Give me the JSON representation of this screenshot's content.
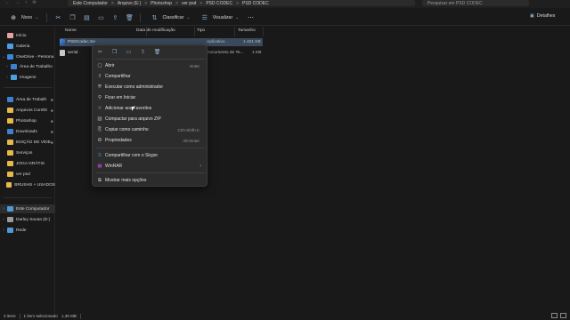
{
  "address": {
    "crumbs": [
      "Este Computador",
      "Arquivo (E:)",
      "Photoshop",
      "ver psd",
      "PSD CODEC",
      "PSD CODEC"
    ],
    "separator": ">",
    "search_placeholder": "Pesquisar em PSD CODEC"
  },
  "toolbar": {
    "new_label": "Novo",
    "sort_label": "Classificar",
    "view_label": "Visualizar",
    "details_label": "Detalhes"
  },
  "sidebar": {
    "items": [
      {
        "label": "Início",
        "icon": "home-icon"
      },
      {
        "label": "Galeria",
        "icon": "gallery-icon"
      },
      {
        "label": "OneDrive - Persona",
        "icon": "cloud-icon"
      },
      {
        "label": "Área de Trabalho",
        "icon": "folder-icon"
      },
      {
        "label": "Imagens",
        "icon": "images-icon"
      },
      {
        "label": "Área de Trabalh",
        "icon": "folder-icon"
      },
      {
        "label": "Arquivos CorelD",
        "icon": "folder-icon"
      },
      {
        "label": "Photoshop",
        "icon": "folder-icon"
      },
      {
        "label": "Downloads",
        "icon": "download-icon"
      },
      {
        "label": "EDIÇÃO DE VÍDE",
        "icon": "folder-icon"
      },
      {
        "label": "Serviços",
        "icon": "folder-icon"
      },
      {
        "label": "JOGA GRÁTIS",
        "icon": "folder-icon"
      },
      {
        "label": "ver psd",
        "icon": "folder-icon"
      },
      {
        "label": "BRUSHS + USADOS",
        "icon": "folder-icon"
      },
      {
        "label": "Este Computador",
        "icon": "computer-icon"
      },
      {
        "label": "Darley Sousa (D:)",
        "icon": "drive-icon"
      },
      {
        "label": "Rede",
        "icon": "network-icon"
      }
    ]
  },
  "columns": {
    "name": "Nome",
    "modified": "Data de modificação",
    "type": "Tipo",
    "size": "Tamanho"
  },
  "files": [
    {
      "name": "PSDCodec.Se",
      "modified": "",
      "type": "Aplicativo",
      "size": "1.401 KB"
    },
    {
      "name": "serial",
      "modified": "",
      "type": "Documento de Te...",
      "size": "1 KB"
    }
  ],
  "menu": {
    "items": [
      {
        "label": "Abrir",
        "shortcut": "Enter"
      },
      {
        "label": "Compartilhar",
        "shortcut": ""
      },
      {
        "label": "Executar como administrador",
        "shortcut": ""
      },
      {
        "label": "Fixar em Iniciar",
        "shortcut": ""
      },
      {
        "label": "Adicionar aos Favoritos",
        "shortcut": ""
      },
      {
        "label": "Compactar para arquivo ZIP",
        "shortcut": ""
      },
      {
        "label": "Copiar como caminho",
        "shortcut": "Ctrl+Shift+C"
      },
      {
        "label": "Propriedades",
        "shortcut": "Alt+Enter"
      },
      {
        "label": "Compartilhar com o Skype",
        "shortcut": ""
      },
      {
        "label": "WinRAR",
        "shortcut": ""
      },
      {
        "label": "Mostrar mais opções",
        "shortcut": ""
      }
    ]
  },
  "status": {
    "count": "2 itens",
    "selected": "1 item selecionado",
    "size": "1,36 MB"
  },
  "colors": {
    "accent": "#8fb4d8",
    "selection": "#3a4a5c",
    "avatar": "#d02a8a"
  }
}
